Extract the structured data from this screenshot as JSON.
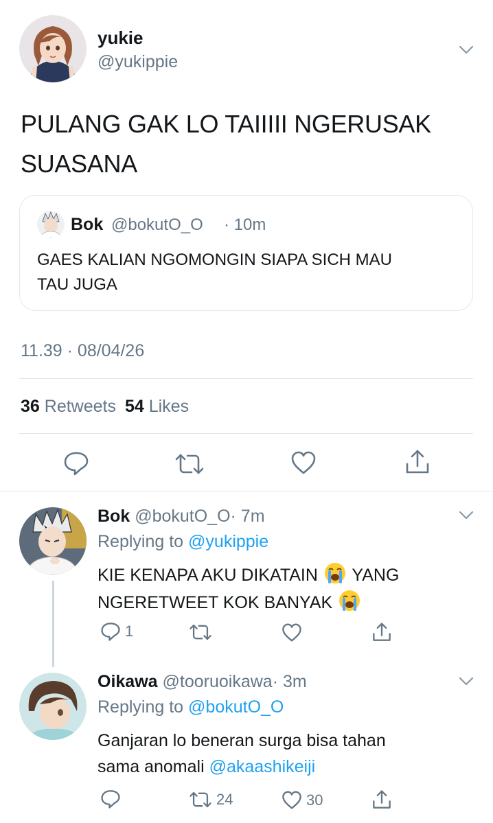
{
  "tweet": {
    "display_name": "yukie",
    "handle": "@yukippie",
    "text_line1": "PULANG GAK LO TAIIIII NGERUSAK",
    "text_line2": "SUASANA",
    "quoted": {
      "display_name": "Bok",
      "handle": "@bokutO_O",
      "time": "· 10m",
      "text_line1": "GAES KALIAN NGOMONGIN SIAPA SICH MAU",
      "text_line2": "TAU JUGA"
    },
    "timestamp": "11.39 · 08/04/26",
    "retweet_count": "36",
    "retweets_label": "Retweets",
    "like_count": "54",
    "likes_label": "Likes"
  },
  "replies": [
    {
      "display_name": "Bok",
      "handle": "@bokutO_O",
      "time": "· 7m",
      "replying_prefix": "Replying to",
      "replying_to": "@yukippie",
      "text_line1a": "KIE KENAPA AKU DIKATAIN",
      "text_line1b": "YANG",
      "text_line2": "NGERETWEET KOK BANYAK",
      "reply_count": "1",
      "retweet_count": "",
      "like_count": ""
    },
    {
      "display_name": "Oikawa",
      "handle": "@tooruoikawa",
      "time": "· 3m",
      "replying_prefix": "Replying to",
      "replying_to": "@bokutO_O",
      "text_line1": "Ganjaran lo beneran surga bisa tahan",
      "text_line2_prefix": "sama anomali",
      "mention": "@akaashikeiji",
      "reply_count": "",
      "retweet_count": "24",
      "like_count": "30"
    }
  ],
  "colors": {
    "link": "#1da1f2",
    "secondary": "#657786",
    "border": "#e1e8ed",
    "text": "#14171a"
  },
  "icons": [
    "reply-icon",
    "retweet-icon",
    "like-icon",
    "share-icon",
    "chevron-down-icon",
    "crying-face-emoji"
  ]
}
